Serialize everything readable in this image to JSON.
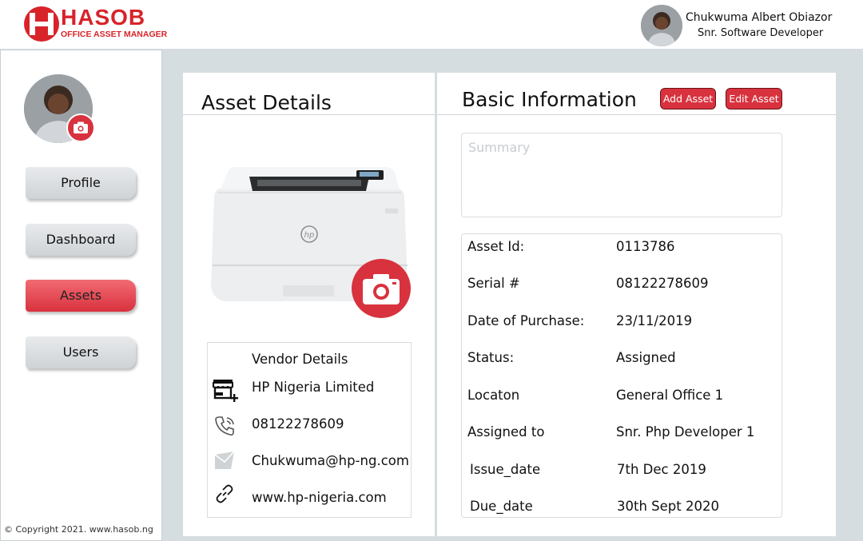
{
  "brand": {
    "name": "HASOB",
    "tagline": "OFFICE ASSET MANAGER"
  },
  "user": {
    "name": "Chukwuma Albert Obiazor",
    "role": "Snr. Software Developer"
  },
  "sidebar": {
    "items": [
      {
        "label": "Profile",
        "active": false
      },
      {
        "label": "Dashboard",
        "active": false
      },
      {
        "label": "Assets",
        "active": true
      },
      {
        "label": "Users",
        "active": false
      }
    ],
    "copyright": "Copyright 2021. www.hasob.ng"
  },
  "asset_details": {
    "title": "Asset Details",
    "vendor": {
      "title": "Vendor Details",
      "name": "HP Nigeria Limited",
      "phone": "08122278609",
      "email": "Chukwuma@hp-ng.com",
      "website": "www.hp-nigeria.com"
    }
  },
  "basic_info": {
    "title": "Basic Information",
    "add_label": "Add Asset",
    "edit_label": "Edit Asset",
    "summary_placeholder": "Summary",
    "fields": [
      {
        "label": "Asset Id:",
        "value": "0113786"
      },
      {
        "label": "Serial #",
        "value": "08122278609"
      },
      {
        "label": "Date of Purchase:",
        "value": "23/11/2019"
      },
      {
        "label": "Status:",
        "value": "Assigned"
      },
      {
        "label": "Locaton",
        "value": "General Office 1"
      },
      {
        "label": "Assigned to",
        "value": "Snr. Php Developer 1"
      },
      {
        "label": "Issue_date",
        "value": "7th Dec 2019"
      },
      {
        "label": "Due_date",
        "value": "30th Sept 2020"
      }
    ]
  },
  "colors": {
    "accent": "#d8323e",
    "brand": "#d8232a",
    "background": "#d6dde0"
  }
}
